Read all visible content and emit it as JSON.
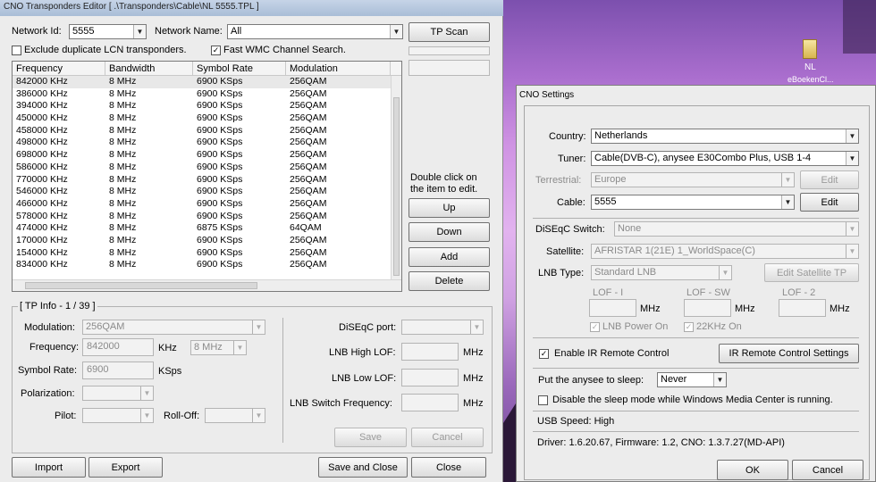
{
  "editor": {
    "title": "CNO Transponders Editor  [ .\\Transponders\\Cable\\NL 5555.TPL ]",
    "network_id_label": "Network Id:",
    "network_id_value": "5555",
    "network_name_label": "Network Name:",
    "network_name_value": "All",
    "tp_scan": "TP Scan",
    "exclude_duplicate": "Exclude duplicate LCN transponders.",
    "fast_wmc": "Fast WMC Channel Search.",
    "columns": [
      "Frequency",
      "Bandwidth",
      "Symbol Rate",
      "Modulation"
    ],
    "rows": [
      [
        "842000 KHz",
        "8 MHz",
        "6900 KSps",
        "256QAM"
      ],
      [
        "386000 KHz",
        "8 MHz",
        "6900 KSps",
        "256QAM"
      ],
      [
        "394000 KHz",
        "8 MHz",
        "6900 KSps",
        "256QAM"
      ],
      [
        "450000 KHz",
        "8 MHz",
        "6900 KSps",
        "256QAM"
      ],
      [
        "458000 KHz",
        "8 MHz",
        "6900 KSps",
        "256QAM"
      ],
      [
        "498000 KHz",
        "8 MHz",
        "6900 KSps",
        "256QAM"
      ],
      [
        "698000 KHz",
        "8 MHz",
        "6900 KSps",
        "256QAM"
      ],
      [
        "586000 KHz",
        "8 MHz",
        "6900 KSps",
        "256QAM"
      ],
      [
        "770000 KHz",
        "8 MHz",
        "6900 KSps",
        "256QAM"
      ],
      [
        "546000 KHz",
        "8 MHz",
        "6900 KSps",
        "256QAM"
      ],
      [
        "466000 KHz",
        "8 MHz",
        "6900 KSps",
        "256QAM"
      ],
      [
        "578000 KHz",
        "8 MHz",
        "6900 KSps",
        "256QAM"
      ],
      [
        "474000 KHz",
        "8 MHz",
        "6875 KSps",
        "64QAM"
      ],
      [
        "170000 KHz",
        "8 MHz",
        "6900 KSps",
        "256QAM"
      ],
      [
        "154000 KHz",
        "8 MHz",
        "6900 KSps",
        "256QAM"
      ],
      [
        "834000 KHz",
        "8 MHz",
        "6900 KSps",
        "256QAM"
      ]
    ],
    "hint": "Double click on the item to edit.",
    "up": "Up",
    "down": "Down",
    "add": "Add",
    "delete": "Delete",
    "tp_info": "[ TP Info - 1 / 39 ]",
    "modulation_label": "Modulation:",
    "modulation_value": "256QAM",
    "frequency_label": "Frequency:",
    "frequency_value": "842000",
    "khz": "KHz",
    "bandwidth_value": "8 MHz",
    "symbol_rate_label": "Symbol Rate:",
    "symbol_rate_value": "6900",
    "ksps": "KSps",
    "polarization_label": "Polarization:",
    "pilot_label": "Pilot:",
    "rolloff_label": "Roll-Off:",
    "diseqc_port_label": "DiSEqC port:",
    "lnb_high_label": "LNB High LOF:",
    "lnb_low_label": "LNB Low LOF:",
    "lnb_switch_label": "LNB Switch Frequency:",
    "mhz": "MHz",
    "save": "Save",
    "cancel": "Cancel",
    "import": "Import",
    "export": "Export",
    "save_and_close": "Save and Close",
    "close": "Close"
  },
  "desktop": {
    "icon_label1": "NL",
    "icon_label2": "eBoekenCl..."
  },
  "settings": {
    "title": "CNO Settings",
    "country_label": "Country:",
    "country_value": "Netherlands",
    "tuner_label": "Tuner:",
    "tuner_value": "Cable(DVB-C), anysee E30Combo Plus, USB 1-4",
    "terrestrial_label": "Terrestrial:",
    "terrestrial_value": "Europe",
    "edit": "Edit",
    "cable_label": "Cable:",
    "cable_value": "5555",
    "diseqc_label": "DiSEqC Switch:",
    "diseqc_value": "None",
    "satellite_label": "Satellite:",
    "satellite_value": "AFRISTAR 1(21E) 1_WorldSpace(C)",
    "lnb_type_label": "LNB Type:",
    "lnb_type_value": "Standard LNB",
    "edit_satellite_tp": "Edit Satellite TP",
    "lof_i": "LOF - I",
    "lof_sw": "LOF - SW",
    "lof_2": "LOF - 2",
    "mhz": "MHz",
    "lnb_power": "LNB Power On",
    "khz22": "22KHz On",
    "enable_ir": "Enable IR Remote Control",
    "ir_settings": "IR Remote Control Settings",
    "sleep_label": "Put the anysee to sleep:",
    "sleep_value": "Never",
    "disable_sleep": "Disable the sleep mode while Windows Media Center is running.",
    "usb_speed": "USB Speed: High",
    "driver_info": "Driver: 1.6.20.67,  Firmware: 1.2,  CNO: 1.3.7.27(MD-API)",
    "ok": "OK",
    "cancel": "Cancel"
  }
}
